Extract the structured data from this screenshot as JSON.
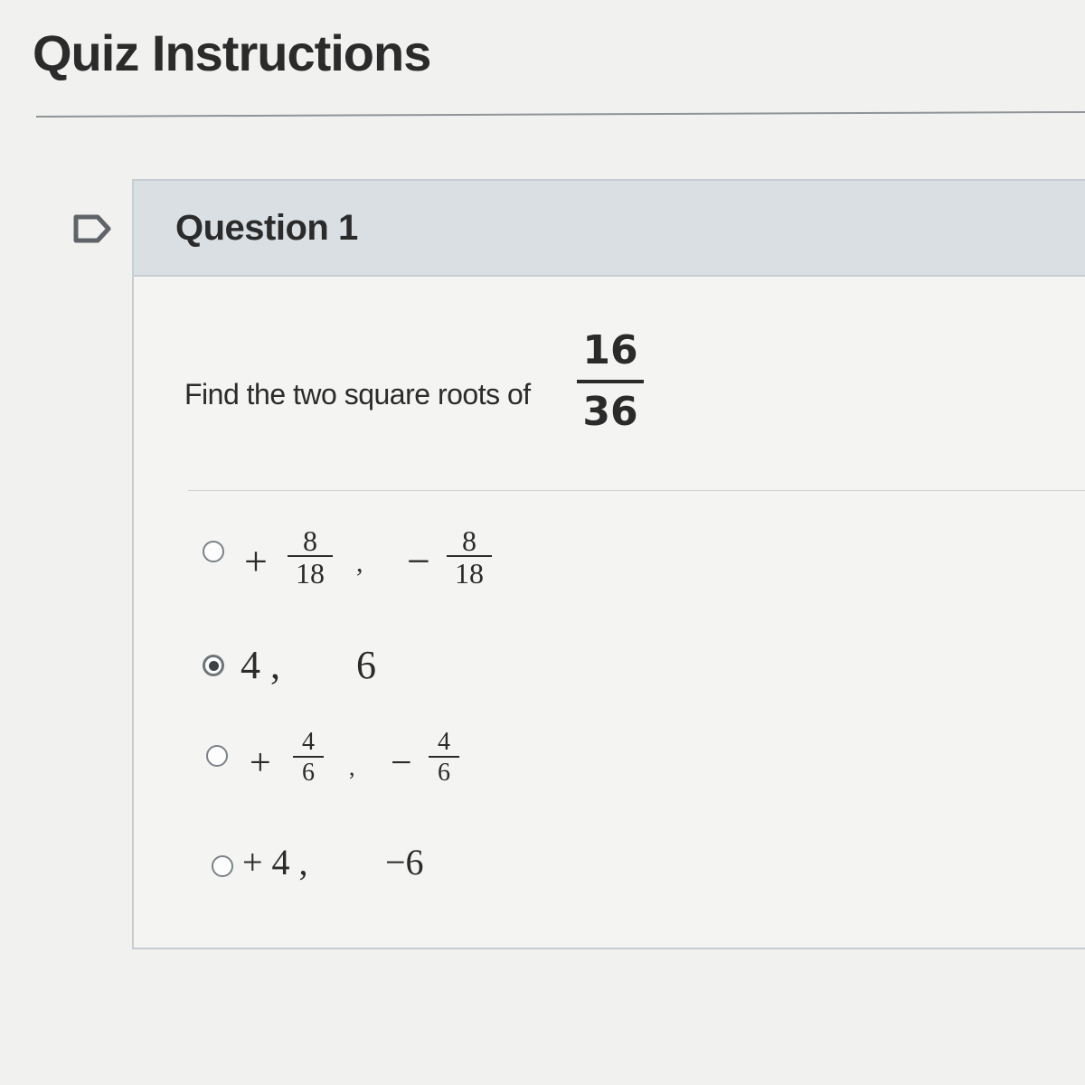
{
  "page": {
    "title": "Quiz Instructions"
  },
  "question": {
    "title": "Question 1",
    "prompt": "Find the two square roots of",
    "fraction": {
      "numerator": "16",
      "denominator": "36"
    }
  },
  "answers": [
    {
      "selected": false,
      "first": {
        "sign": "+",
        "numerator": "8",
        "denominator": "18"
      },
      "separator": ",",
      "second": {
        "sign": "−",
        "numerator": "8",
        "denominator": "18"
      }
    },
    {
      "selected": true,
      "text": "4 ,",
      "second_text": "6"
    },
    {
      "selected": false,
      "first": {
        "sign": "+",
        "numerator": "4",
        "denominator": "6"
      },
      "separator": ",",
      "second": {
        "sign": "−",
        "numerator": "4",
        "denominator": "6"
      }
    },
    {
      "selected": false,
      "text": "+ 4 ,",
      "second_text": "−6"
    }
  ]
}
